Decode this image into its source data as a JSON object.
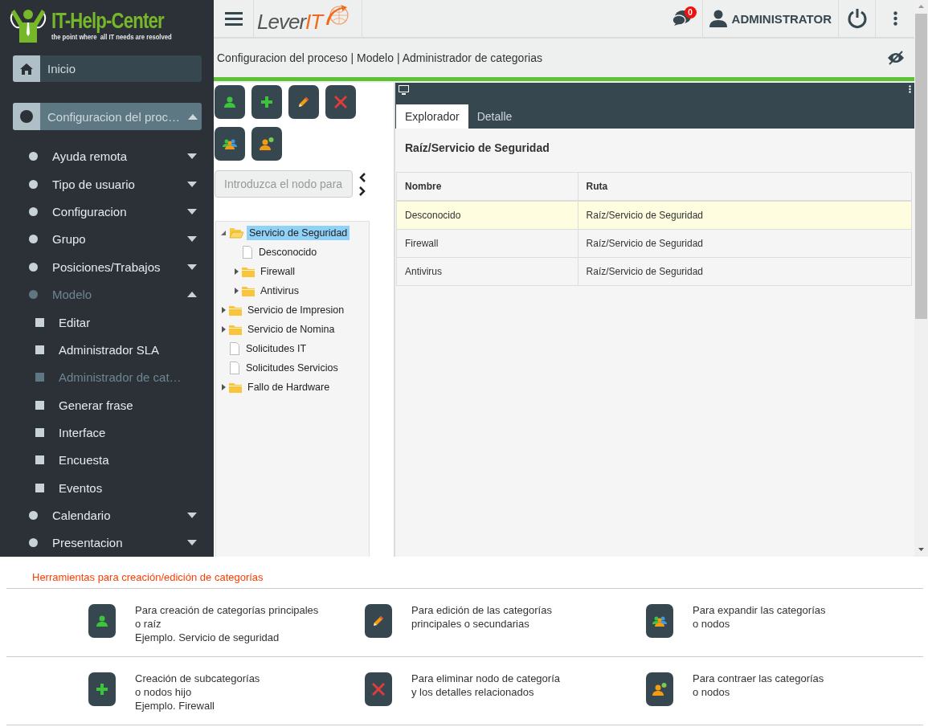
{
  "logo": {
    "title": "IT-Help-Center",
    "tagline": "the point where  all IT needs are resolved"
  },
  "header": {
    "brand": "Lever",
    "brand_accent": "IT",
    "notifications": "0",
    "user": "ADMINISTRATOR"
  },
  "sidebar": {
    "items": [
      {
        "label": "Inicio",
        "kind": "home",
        "selected": false
      },
      {
        "label": "Configuracion del proc…",
        "kind": "group",
        "selected": true,
        "expanded": true,
        "children": [
          {
            "label": "Ayuda remota",
            "selected": false,
            "expanded": false
          },
          {
            "label": "Tipo de usuario",
            "selected": false,
            "expanded": false
          },
          {
            "label": "Configuracion",
            "selected": false,
            "expanded": false
          },
          {
            "label": "Grupo",
            "selected": false,
            "expanded": false
          },
          {
            "label": "Posiciones/Trabajos",
            "selected": false,
            "expanded": false
          },
          {
            "label": "Modelo",
            "selected": true,
            "expanded": true,
            "children": [
              {
                "label": "Editar",
                "selected": false
              },
              {
                "label": "Administrador SLA",
                "selected": false
              },
              {
                "label": "Administrador de cat…",
                "selected": true
              },
              {
                "label": "Generar frase",
                "selected": false
              },
              {
                "label": "Interface",
                "selected": false
              },
              {
                "label": "Encuesta",
                "selected": false
              },
              {
                "label": "Eventos",
                "selected": false
              }
            ]
          },
          {
            "label": "Calendario",
            "selected": false,
            "expanded": false
          },
          {
            "label": "Presentacion",
            "selected": false,
            "expanded": false
          }
        ]
      }
    ]
  },
  "breadcrumb": "Configuracion del proceso | Modelo | Administrador de categorias",
  "toolbar": [
    {
      "kind": "add-root"
    },
    {
      "kind": "add-child"
    },
    {
      "kind": "edit"
    },
    {
      "kind": "delete"
    },
    {
      "kind": "expand"
    },
    {
      "kind": "collapse"
    }
  ],
  "search": {
    "placeholder": "Introduzca el nodo para"
  },
  "tree": [
    {
      "label": "Servicio de Seguridad",
      "kind": "folder",
      "expanded": true,
      "selected": true,
      "children": [
        {
          "label": "Desconocido",
          "kind": "file",
          "selected": false
        },
        {
          "label": "Firewall",
          "kind": "folder",
          "expanded": false,
          "selected": false
        },
        {
          "label": "Antivirus",
          "kind": "folder",
          "expanded": false,
          "selected": false
        }
      ]
    },
    {
      "label": "Servicio de Impresion",
      "kind": "folder",
      "expanded": false,
      "selected": false
    },
    {
      "label": "Servicio de Nomina",
      "kind": "folder",
      "expanded": false,
      "selected": false
    },
    {
      "label": "Solicitudes IT",
      "kind": "file",
      "selected": false
    },
    {
      "label": "Solicitudes Servicios",
      "kind": "file",
      "selected": false
    },
    {
      "label": "Fallo de Hardware",
      "kind": "folder",
      "expanded": false,
      "selected": false
    }
  ],
  "panel": {
    "tabs": [
      {
        "label": "Explorador",
        "selected": true
      },
      {
        "label": "Detalle",
        "selected": false
      }
    ],
    "title": "Raíz/Servicio de Seguridad",
    "table": {
      "columns": [
        "Nombre",
        "Ruta"
      ],
      "rows": [
        {
          "cells": [
            "Desconocido",
            "Raíz/Servicio de Seguridad"
          ],
          "selected": true
        },
        {
          "cells": [
            "Firewall",
            "Raíz/Servicio de Seguridad"
          ],
          "selected": false
        },
        {
          "cells": [
            "Antivirus",
            "Raíz/Servicio de Seguridad"
          ],
          "selected": false
        }
      ]
    }
  },
  "legend": {
    "title": "Herramientas para creación/edición de categorías",
    "items": [
      {
        "kind": "add-root",
        "lines": [
          "Para creación de categorías principales",
          "o raíz",
          "Ejemplo. Servicio de seguridad"
        ]
      },
      {
        "kind": "edit",
        "lines": [
          "Para edición de las categorías",
          "principales o secundarias"
        ]
      },
      {
        "kind": "expand",
        "lines": [
          "Para expandir las categorías",
          "o nodos"
        ]
      },
      {
        "kind": "add-child",
        "lines": [
          "Creación de subcategorías",
          "o nodos hijo",
          "Ejemplo. Firewall"
        ]
      },
      {
        "kind": "delete",
        "lines": [
          "Para eliminar nodo de categoría",
          "y los detalles relacionados"
        ]
      },
      {
        "kind": "collapse",
        "lines": [
          "Para contraer las categorías",
          "o nodos"
        ]
      }
    ]
  }
}
